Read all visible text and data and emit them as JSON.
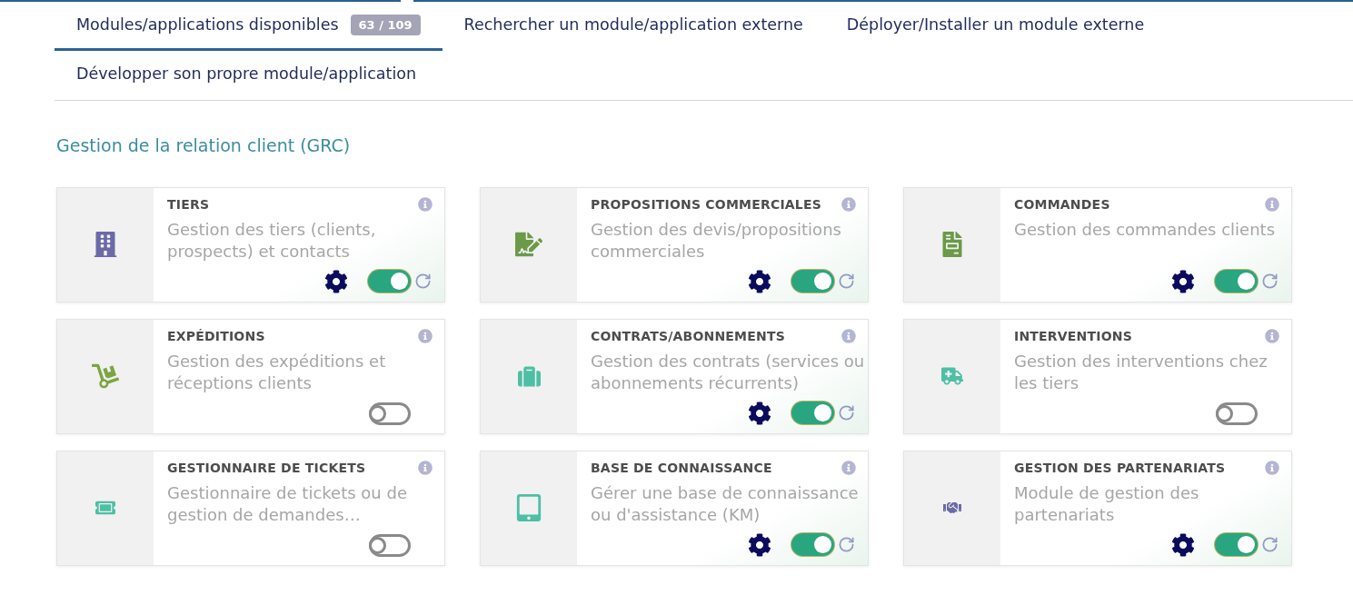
{
  "tabs": [
    {
      "label": "Modules/applications disponibles",
      "badge": "63 / 109",
      "selected": true
    },
    {
      "label": "Rechercher un module/application externe",
      "selected": false
    },
    {
      "label": "Déployer/Installer un module externe",
      "selected": false
    },
    {
      "label": "Développer son propre module/application",
      "selected": false
    }
  ],
  "section": {
    "title": "Gestion de la relation client (GRC)",
    "modules": [
      {
        "title": "TIERS",
        "description": "Gestion des tiers (clients, prospects) et contacts",
        "color": "#6b6aa6",
        "enabled": true
      },
      {
        "title": "PROPOSITIONS COMMERCIALES",
        "description": "Gestion des devis/propositions commerciales",
        "color": "#6b9a48",
        "enabled": true
      },
      {
        "title": "COMMANDES",
        "description": "Gestion des commandes clients",
        "color": "#6b9a48",
        "enabled": true
      },
      {
        "title": "EXPÉDITIONS",
        "description": "Gestion des expéditions et réceptions clients",
        "color": "#7ba542",
        "enabled": false
      },
      {
        "title": "CONTRATS/ABONNEMENTS",
        "description": "Gestion des contrats (services ou abonnements récurrents)",
        "color": "#4dbfa5",
        "enabled": true
      },
      {
        "title": "INTERVENTIONS",
        "description": "Gestion des interventions chez les tiers",
        "color": "#4dbfa5",
        "enabled": false
      },
      {
        "title": "GESTIONNAIRE DE TICKETS",
        "description": "Gestionnaire de tickets ou de gestion de demandes…",
        "color": "#4dbfa5",
        "enabled": false
      },
      {
        "title": "BASE DE CONNAISSANCE",
        "description": "Gérer une base de connaissance ou d'assistance (KM)",
        "color": "#4dbfa5",
        "enabled": true
      },
      {
        "title": "GESTION DES PARTENARIATS",
        "description": "Module de gestion des partenariats",
        "color": "#6b6aa6",
        "enabled": true
      }
    ]
  }
}
